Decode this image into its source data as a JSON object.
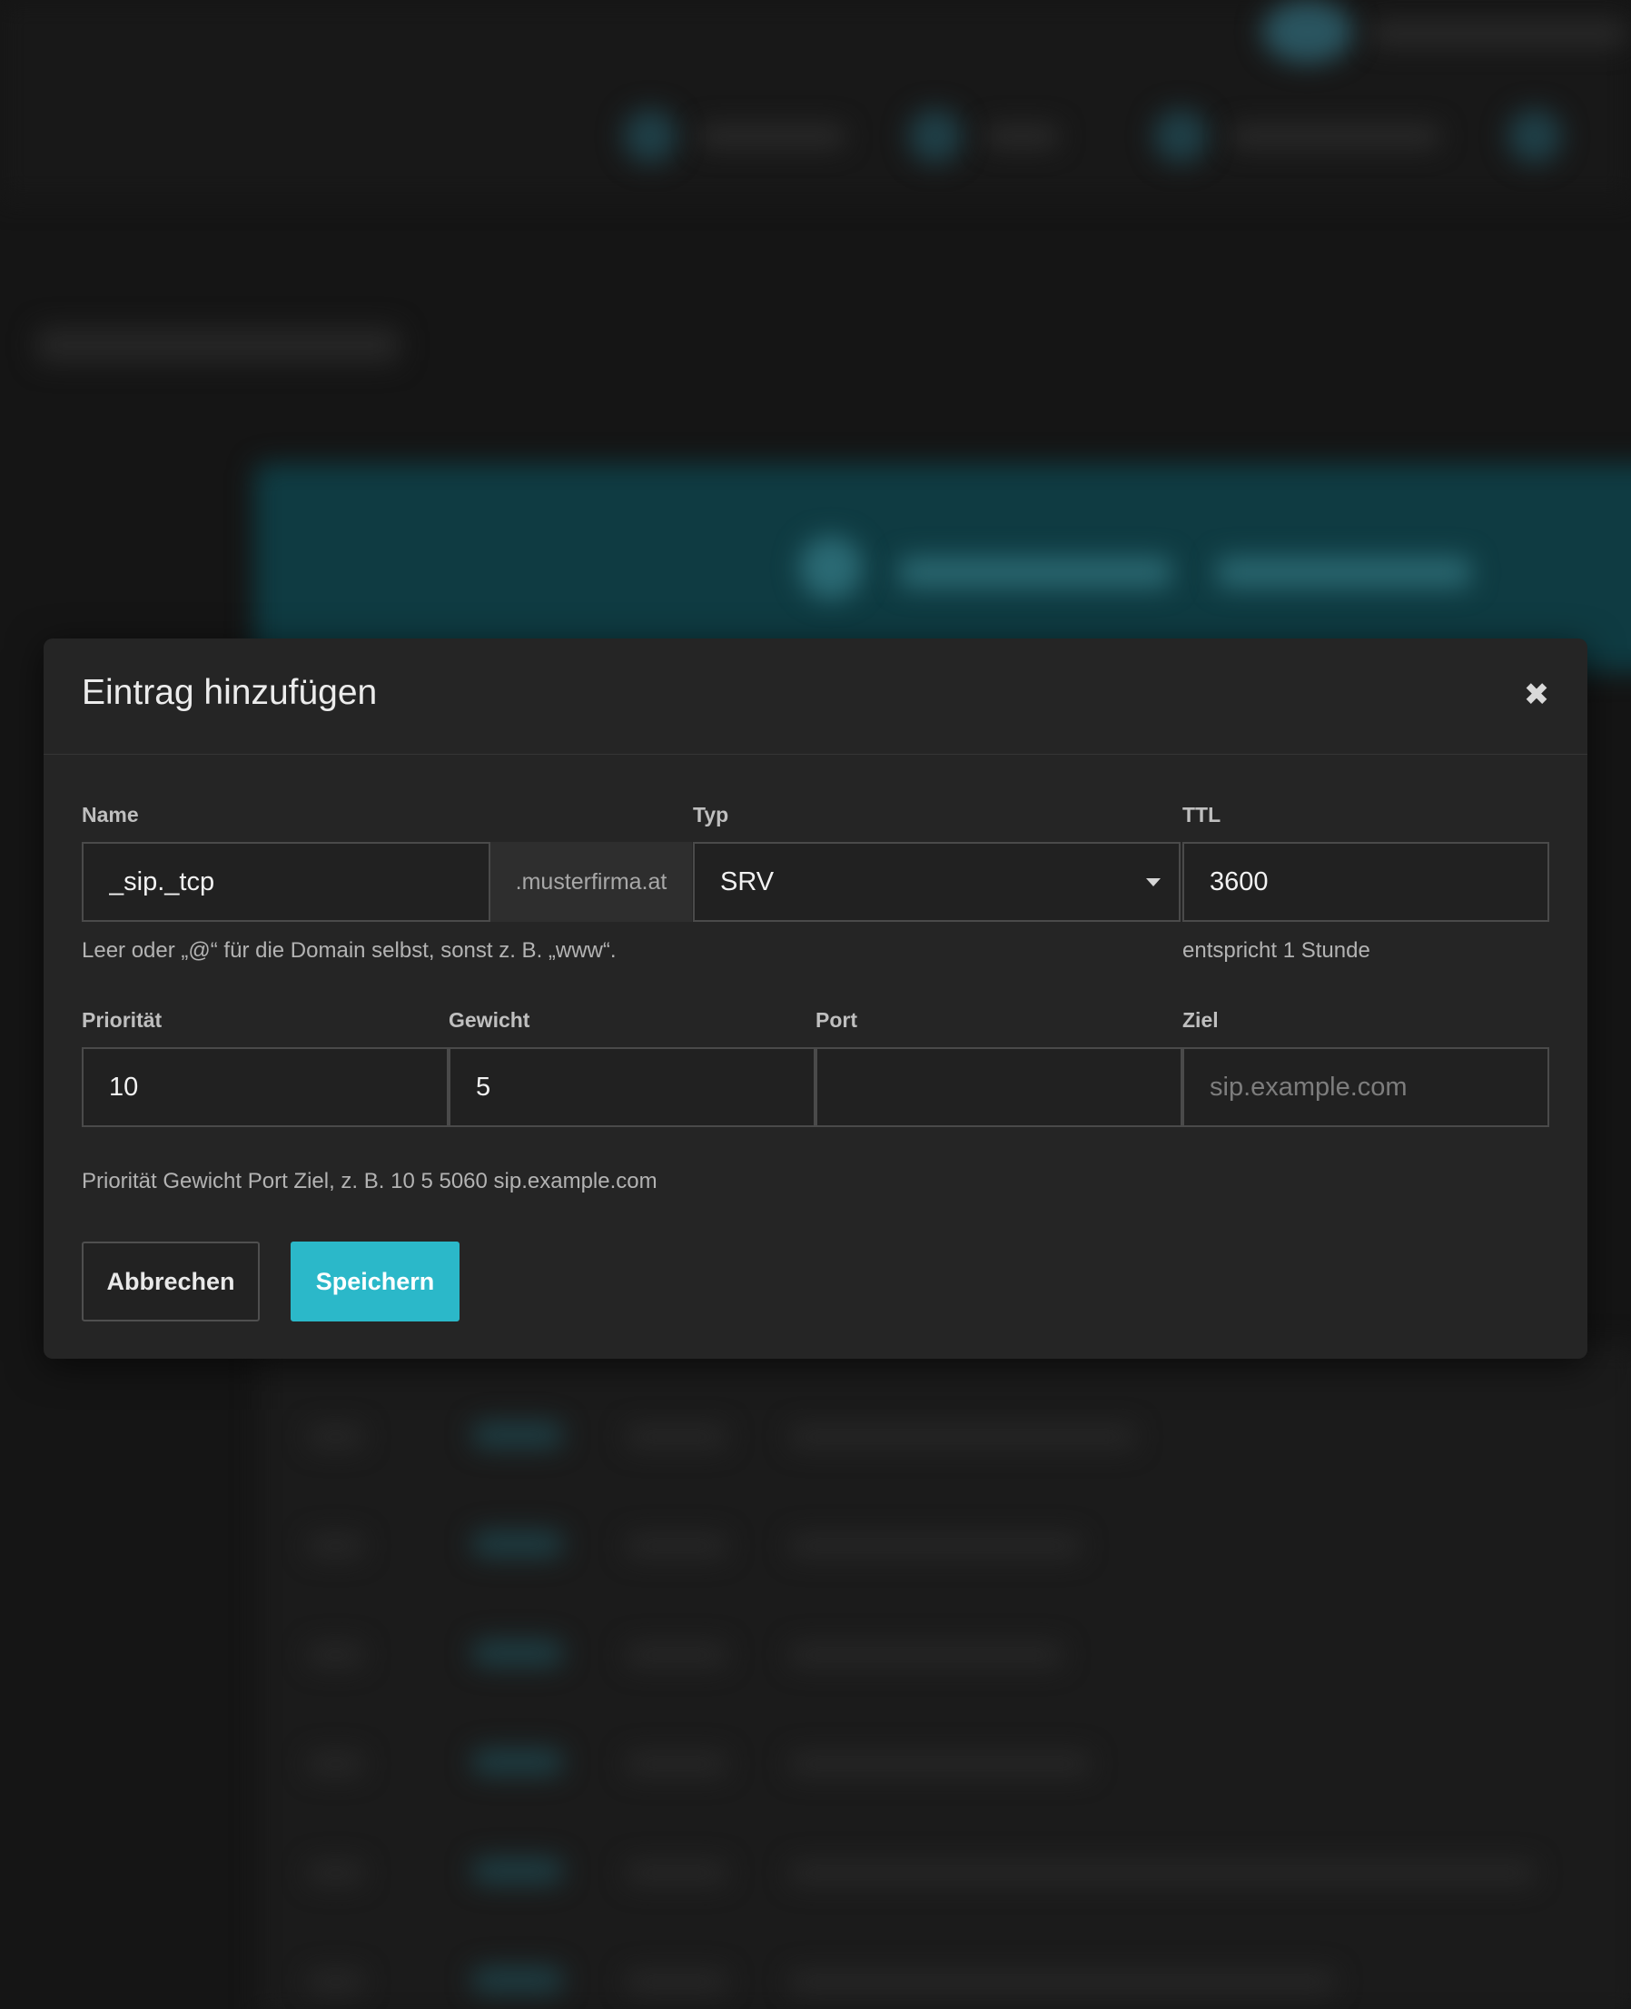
{
  "colors": {
    "accent": "#2bb8c9",
    "modal_background": "#252525",
    "page_background": "#161616"
  },
  "dialog": {
    "title": "Eintrag hinzufügen",
    "close_icon": "close-icon"
  },
  "form": {
    "name": {
      "label": "Name",
      "value": "_sip._tcp",
      "suffix": ".musterfirma.at",
      "help": "Leer oder „@“ für die Domain selbst, sonst z. B. „www“."
    },
    "type": {
      "label": "Typ",
      "selected": "SRV",
      "icon": "chevron-down-icon"
    },
    "ttl": {
      "label": "TTL",
      "value": "3600",
      "help": "entspricht 1 Stunde"
    },
    "priority": {
      "label": "Priorität",
      "value": "10"
    },
    "weight": {
      "label": "Gewicht",
      "value": "5"
    },
    "port": {
      "label": "Port",
      "value": ""
    },
    "target": {
      "label": "Ziel",
      "value": "",
      "placeholder": "sip.example.com"
    },
    "srv_help": "Priorität Gewicht Port Ziel, z. B. 10 5 5060 sip.example.com"
  },
  "buttons": {
    "cancel": "Abbrechen",
    "save": "Speichern"
  }
}
